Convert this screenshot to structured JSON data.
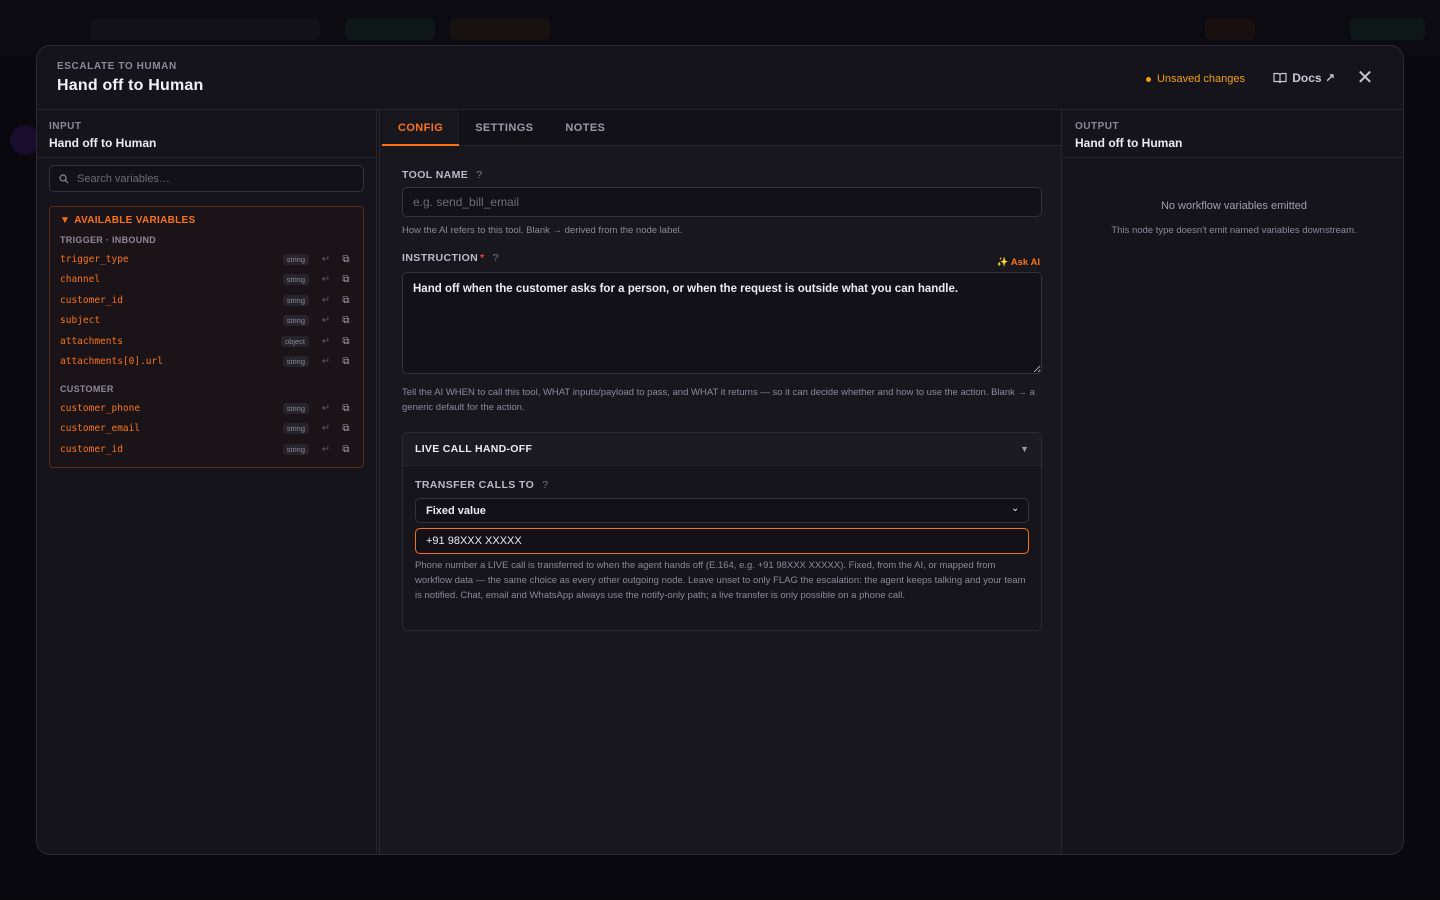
{
  "modal": {
    "eyebrow": "ESCALATE TO HUMAN",
    "title": "Hand off to Human",
    "unsaved": "Unsaved changes",
    "docs": "Docs ↗",
    "close": "✕"
  },
  "input_panel": {
    "label": "INPUT",
    "value": "Hand off to Human",
    "search_placeholder": "Search variables…",
    "vars_header": "AVAILABLE VARIABLES",
    "groups": [
      {
        "label": "TRIGGER · INBOUND",
        "items": [
          {
            "name": "trigger_type",
            "type": "string"
          },
          {
            "name": "channel",
            "type": "string"
          },
          {
            "name": "customer_id",
            "type": "string"
          },
          {
            "name": "subject",
            "type": "string"
          },
          {
            "name": "attachments",
            "type": "object"
          },
          {
            "name": "attachments[0].url",
            "type": "string"
          }
        ]
      },
      {
        "label": "CUSTOMER",
        "items": [
          {
            "name": "customer_phone",
            "type": "string"
          },
          {
            "name": "customer_email",
            "type": "string"
          },
          {
            "name": "customer_id",
            "type": "string"
          }
        ]
      }
    ]
  },
  "tabs": [
    "CONFIG",
    "SETTINGS",
    "NOTES"
  ],
  "config": {
    "tool_name_label": "TOOL NAME",
    "tool_name_placeholder": "e.g. send_bill_email",
    "tool_name_value": "",
    "tool_name_help": "How the AI refers to this tool. Blank → derived from the node label.",
    "instruction_label": "INSTRUCTION",
    "instruction_required": "*",
    "ask_ai": "✨ Ask AI",
    "instruction_value": "Hand off when the customer asks for a person, or when the request is outside what you can handle.",
    "instruction_help": "Tell the AI WHEN to call this tool, WHAT inputs/payload to pass, and WHAT it returns — so it can decide whether and how to use the action. Blank → a generic default for the action.",
    "section_title": "LIVE CALL HAND-OFF",
    "transfer_label": "TRANSFER CALLS TO",
    "transfer_mode": "Fixed value",
    "transfer_value": "+91 98XXX XXXXX",
    "transfer_help": "Phone number a LIVE call is transferred to when the agent hands off (E.164, e.g. +91 98XXX XXXXX). Fixed, from the AI, or mapped from workflow data — the same choice as every other outgoing node. Leave unset to only FLAG the escalation: the agent keeps talking and your team is notified. Chat, email and WhatsApp always use the notify-only path; a live transfer is only possible on a phone call."
  },
  "output_panel": {
    "label": "OUTPUT",
    "value": "Hand off to Human",
    "empty_title": "No workflow variables emitted",
    "empty_sub": "This node type doesn't emit named variables downstream."
  },
  "colors": {
    "accent": "#f97316",
    "warning": "#f59e0b",
    "required": "#ef4444"
  }
}
